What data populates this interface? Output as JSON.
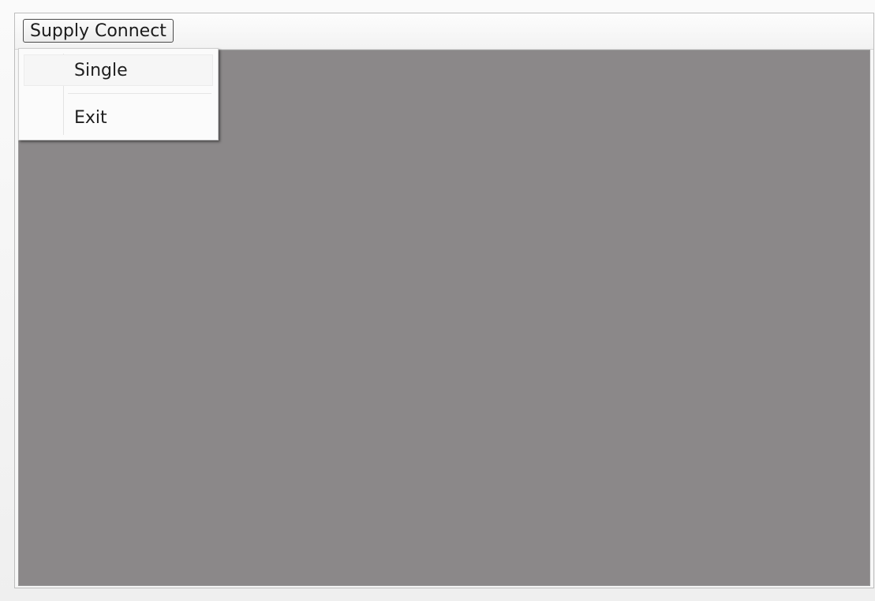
{
  "menubar": {
    "items": [
      {
        "label": "Supply Connect"
      }
    ]
  },
  "dropdown": {
    "items": [
      {
        "label": "Single"
      },
      {
        "label": "Exit"
      }
    ]
  },
  "colors": {
    "workspace": "#8b8889",
    "menu_background": "#fbfbfb",
    "text": "#1f1f1f"
  }
}
